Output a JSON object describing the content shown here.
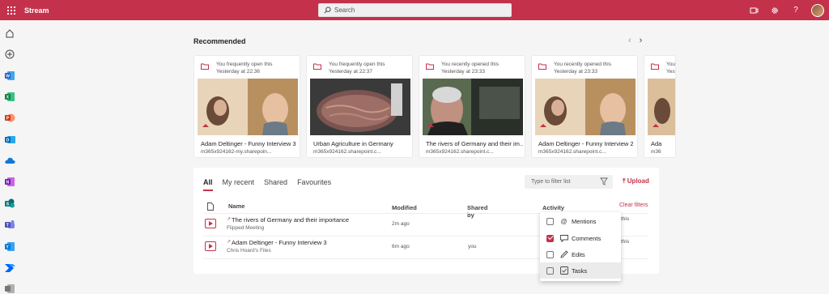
{
  "app": {
    "name": "Stream"
  },
  "search": {
    "placeholder": "Search"
  },
  "rail": [
    "home-icon",
    "create-icon",
    "word-icon",
    "excel-icon",
    "powerpoint-icon",
    "outlook-icon",
    "onedrive-icon",
    "onenote-icon",
    "sharepoint-icon",
    "teams-icon",
    "viva-engage-icon",
    "power-automate-icon",
    "forms-icon"
  ],
  "recommended": {
    "title": "Recommended",
    "cards": [
      {
        "meta1": "You frequently open this",
        "meta2": "Yesterday at 22:36",
        "title": "Adam Deltinger - Funny Interview 3",
        "sub": "m365x924162-my.sharepoin...",
        "thumb": "interview"
      },
      {
        "meta1": "You frequently open this",
        "meta2": "Yesterday at 22:37",
        "title": "Urban Agriculture in Germany",
        "sub": "m365x924162.sharepoint.c...",
        "thumb": "agri"
      },
      {
        "meta1": "You recently opened this",
        "meta2": "Yesterday at 23:33",
        "title": "The rivers of Germany and their im...",
        "sub": "m365x924162.sharepoint.c...",
        "thumb": "rivers"
      },
      {
        "meta1": "You recently opened this",
        "meta2": "Yesterday at 23:33",
        "title": "Adam Deltinger - Funny Interview 2",
        "sub": "m365x924162.sharepoint.c...",
        "thumb": "interview"
      },
      {
        "meta1": "You",
        "meta2": "Yest",
        "title": "Ada",
        "sub": "m36",
        "thumb": "interview"
      }
    ]
  },
  "files": {
    "tabs": [
      "All",
      "My recent",
      "Shared",
      "Favourites"
    ],
    "filter_placeholder": "Type to filter list",
    "upload_label": "Upload",
    "clear_filters": "Clear filters",
    "columns": {
      "name": "Name",
      "modified": "Modified",
      "shared_by": "Shared by",
      "activity": "Activity"
    },
    "rows": [
      {
        "name": "The rivers of Germany and their importance",
        "location": "Flipped Meeting",
        "modified": "2m ago",
        "shared_by": "",
        "activity": "this"
      },
      {
        "name": "Adam Deltinger - Funny Interview 3",
        "location": "Chris Hoard's Files",
        "modified": "6m ago",
        "shared_by": "you",
        "activity": "this"
      }
    ]
  },
  "activity_menu": [
    {
      "label": "Mentions",
      "checked": false,
      "icon": "at-icon"
    },
    {
      "label": "Comments",
      "checked": true,
      "icon": "comment-icon"
    },
    {
      "label": "Edits",
      "checked": false,
      "icon": "pencil-icon"
    },
    {
      "label": "Tasks",
      "checked": false,
      "icon": "task-checkbox-icon"
    }
  ],
  "colors": {
    "brand": "#c4314b",
    "word": "#185abd",
    "excel": "#107c41",
    "powerpoint": "#c43e1c",
    "teams": "#5b5fc7"
  }
}
